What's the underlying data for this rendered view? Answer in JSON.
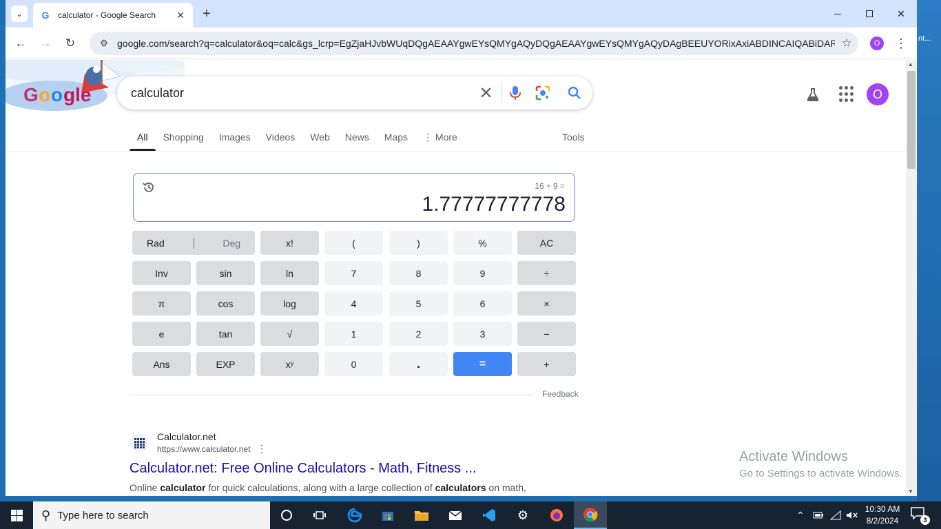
{
  "desktop": {
    "right_edge_text": "nt..."
  },
  "browser": {
    "tab_title": "calculator - Google Search",
    "address": "google.com/search?q=calculator&oq=calc&gs_lcrp=EgZjaHJvbWUqDQgAEAAYgwEYsQMYgAQyDQgAEAAYgwEYsQMYgAQyDAgBEEUYORixAxiABDINCAIQABiDARixAxi...",
    "profile_initial": "O"
  },
  "search": {
    "query": "calculator",
    "tabs": [
      {
        "label": "All"
      },
      {
        "label": "Shopping"
      },
      {
        "label": "Images"
      },
      {
        "label": "Videos"
      },
      {
        "label": "Web"
      },
      {
        "label": "News"
      },
      {
        "label": "Maps"
      },
      {
        "label": "More"
      }
    ],
    "tools_label": "Tools",
    "avatar_initial": "O"
  },
  "calculator": {
    "expression": "16 ÷ 9 =",
    "result": "1.77777777778",
    "keys": {
      "rad": "Rad",
      "deg": "Deg",
      "fact": "x!",
      "lparen": "(",
      "rparen": ")",
      "percent": "%",
      "ac": "AC",
      "inv": "Inv",
      "sin": "sin",
      "ln": "ln",
      "k7": "7",
      "k8": "8",
      "k9": "9",
      "div": "÷",
      "pi": "π",
      "cos": "cos",
      "log": "log",
      "k4": "4",
      "k5": "5",
      "k6": "6",
      "mul": "×",
      "e": "e",
      "tan": "tan",
      "sqrt": "√",
      "k1": "1",
      "k2": "2",
      "k3": "3",
      "minus": "−",
      "ans": "Ans",
      "exp": "EXP",
      "pow": "xʸ",
      "k0": "0",
      "dot": ".",
      "eq": "=",
      "plus": "+"
    },
    "feedback": "Feedback"
  },
  "result": {
    "site": "Calculator.net",
    "url": "https://www.calculator.net",
    "title": "Calculator.net: Free Online Calculators - Math, Fitness ...",
    "snippet_a": "Online ",
    "snippet_b": "calculator",
    "snippet_c": " for quick calculations, along with a large collection of ",
    "snippet_d": "calculators",
    "snippet_e": " on math,"
  },
  "watermark": {
    "line1": "Activate Windows",
    "line2": "Go to Settings to activate Windows."
  },
  "taskbar": {
    "search_placeholder": "Type here to search",
    "time": "10:30 AM",
    "date": "8/2/2024",
    "notifications": "3"
  }
}
